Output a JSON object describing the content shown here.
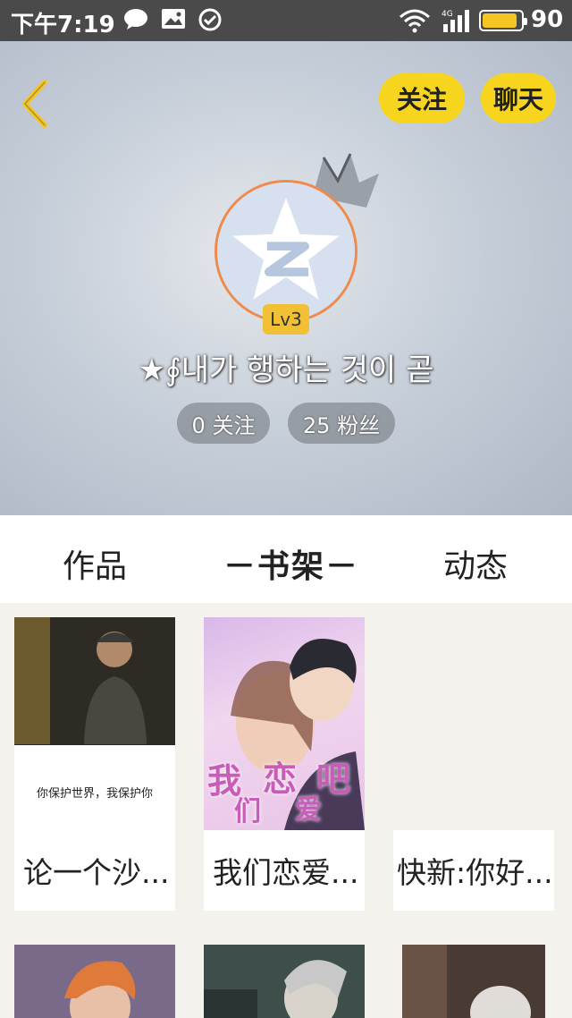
{
  "status_bar": {
    "time": "下午7:19",
    "battery": "90",
    "battery_level": 0.9,
    "network": "4G"
  },
  "header": {
    "follow_label": "关注",
    "chat_label": "聊天",
    "level": "Lv3",
    "username": "★∮내가 행하는 것이 곧",
    "following": "0 关注",
    "fans": "25 粉丝"
  },
  "tabs": {
    "works": "作品",
    "shelf": "－书架－",
    "activity": "动态"
  },
  "books": [
    {
      "title": "论一个沙...",
      "tagline": "你保护世界，我保护你",
      "cover_text": ""
    },
    {
      "title": "我们恋爱...",
      "cover_chars": [
        "我",
        "恋",
        "吧",
        "们",
        "爱"
      ]
    },
    {
      "title": "快新:你好..."
    }
  ],
  "colors": {
    "accent": "#f7d51f",
    "avatar_border": "#f08a4b",
    "level_badge": "#f2c035"
  }
}
